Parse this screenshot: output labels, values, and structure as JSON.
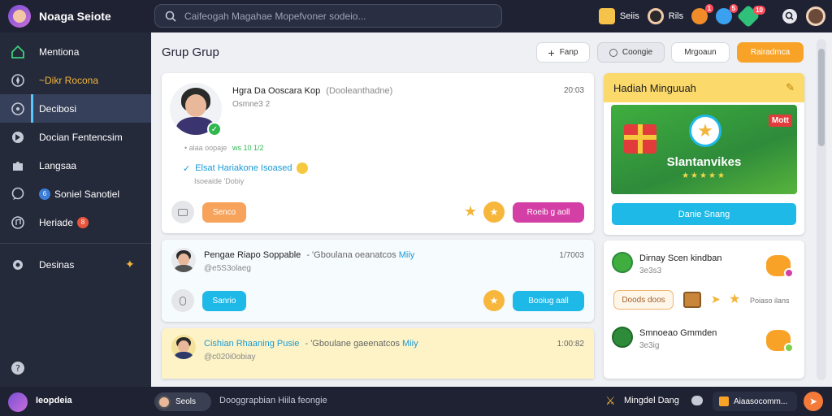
{
  "app": {
    "name": "Noaga Seiote",
    "search_placeholder": "Caifeogah Magahae Mopefvoner sodeio..."
  },
  "topbar": {
    "items": [
      {
        "label": "Seiis",
        "icon": "popcorn-icon",
        "badge": ""
      },
      {
        "label": "Rils",
        "icon": "avatar-icon",
        "badge": ""
      },
      {
        "label": "",
        "icon": "trophy-icon",
        "badge": "1"
      },
      {
        "label": "",
        "icon": "rocket-icon",
        "badge": "5"
      },
      {
        "label": "",
        "icon": "gem-icon",
        "badge": "10"
      },
      {
        "label": "",
        "icon": "search-icon",
        "badge": ""
      },
      {
        "label": "",
        "icon": "profile-icon",
        "badge": ""
      }
    ]
  },
  "sidebar": {
    "items": [
      {
        "label": "Mentiona",
        "icon": "home-icon"
      },
      {
        "label": "~Dikr Rocona",
        "icon": "compass-icon"
      },
      {
        "label": "Decibosi",
        "icon": "chat-icon"
      },
      {
        "label": "Docian Fentencsim",
        "icon": "flag-icon"
      },
      {
        "label": "Langsaa",
        "icon": "puzzle-icon"
      },
      {
        "label": "Soniel Sanotiel",
        "icon": "message-icon",
        "chip": "6"
      },
      {
        "label": "Heriade",
        "icon": "music-icon",
        "chip": "8"
      }
    ],
    "extra_item": {
      "label": "Desinas",
      "icon": "settings-icon"
    }
  },
  "main": {
    "title": "Grup Grup",
    "header_buttons": [
      {
        "label": "Fanp"
      },
      {
        "label": "Coongie"
      },
      {
        "label": "Mrgoaun"
      },
      {
        "label": "Rairadmca"
      }
    ],
    "posts": [
      {
        "name": "Hgra Da Ooscara Kop",
        "meta": "(Dooleanthadne)",
        "handle": "Osmne3 2",
        "info": "• alaa oopaje",
        "stat": "ws 10 1/2",
        "highlight": "Elsat Hariakone Isoased",
        "sub": "Isoeaide 'Dobiy",
        "time": "20:03",
        "tag": "Senco",
        "action": "Roeib g aoll"
      },
      {
        "name": "Pengae Riapo Soppable",
        "meta": "- 'Gboulana oeanatcos",
        "meta_accent": "Miiy",
        "handle": "@e5S3olaeg",
        "time": "1/7003",
        "tag": "Sanrio",
        "action": "Booiug aall"
      },
      {
        "name": "Cishian Rhaaning Pusie",
        "meta": "- 'Gboulane gaeenatcos",
        "meta_accent": "Miiy",
        "handle": "@c020i0obiay",
        "time": "1:00:82"
      }
    ]
  },
  "gift": {
    "title": "Hadiah Minguuah",
    "banner_label": "Slantanvikes",
    "banner_tag": "Mott",
    "button": "Danie Snang"
  },
  "friends": [
    {
      "name": "Dirnay Scen kindban",
      "sub": "3e3s3",
      "button": "Doods doos",
      "extra": "Poiaso ilans"
    },
    {
      "name": "Smnoeao Gmmden",
      "sub": "3e3ig"
    }
  ],
  "bottombar": {
    "user": "Ieopdeia",
    "chat_name": "Seols",
    "chat_preview": "Dooggrapbian Hiila feongie",
    "right_label": "Mingdel Dang",
    "right_status": "Aiaasocomm..."
  },
  "colors": {
    "sidebar_bg": "#252a3b",
    "topbar_bg": "#1f2233",
    "accent_orange": "#f8a327",
    "accent_pink": "#d43fa6",
    "accent_cyan": "#1fb9e8"
  }
}
